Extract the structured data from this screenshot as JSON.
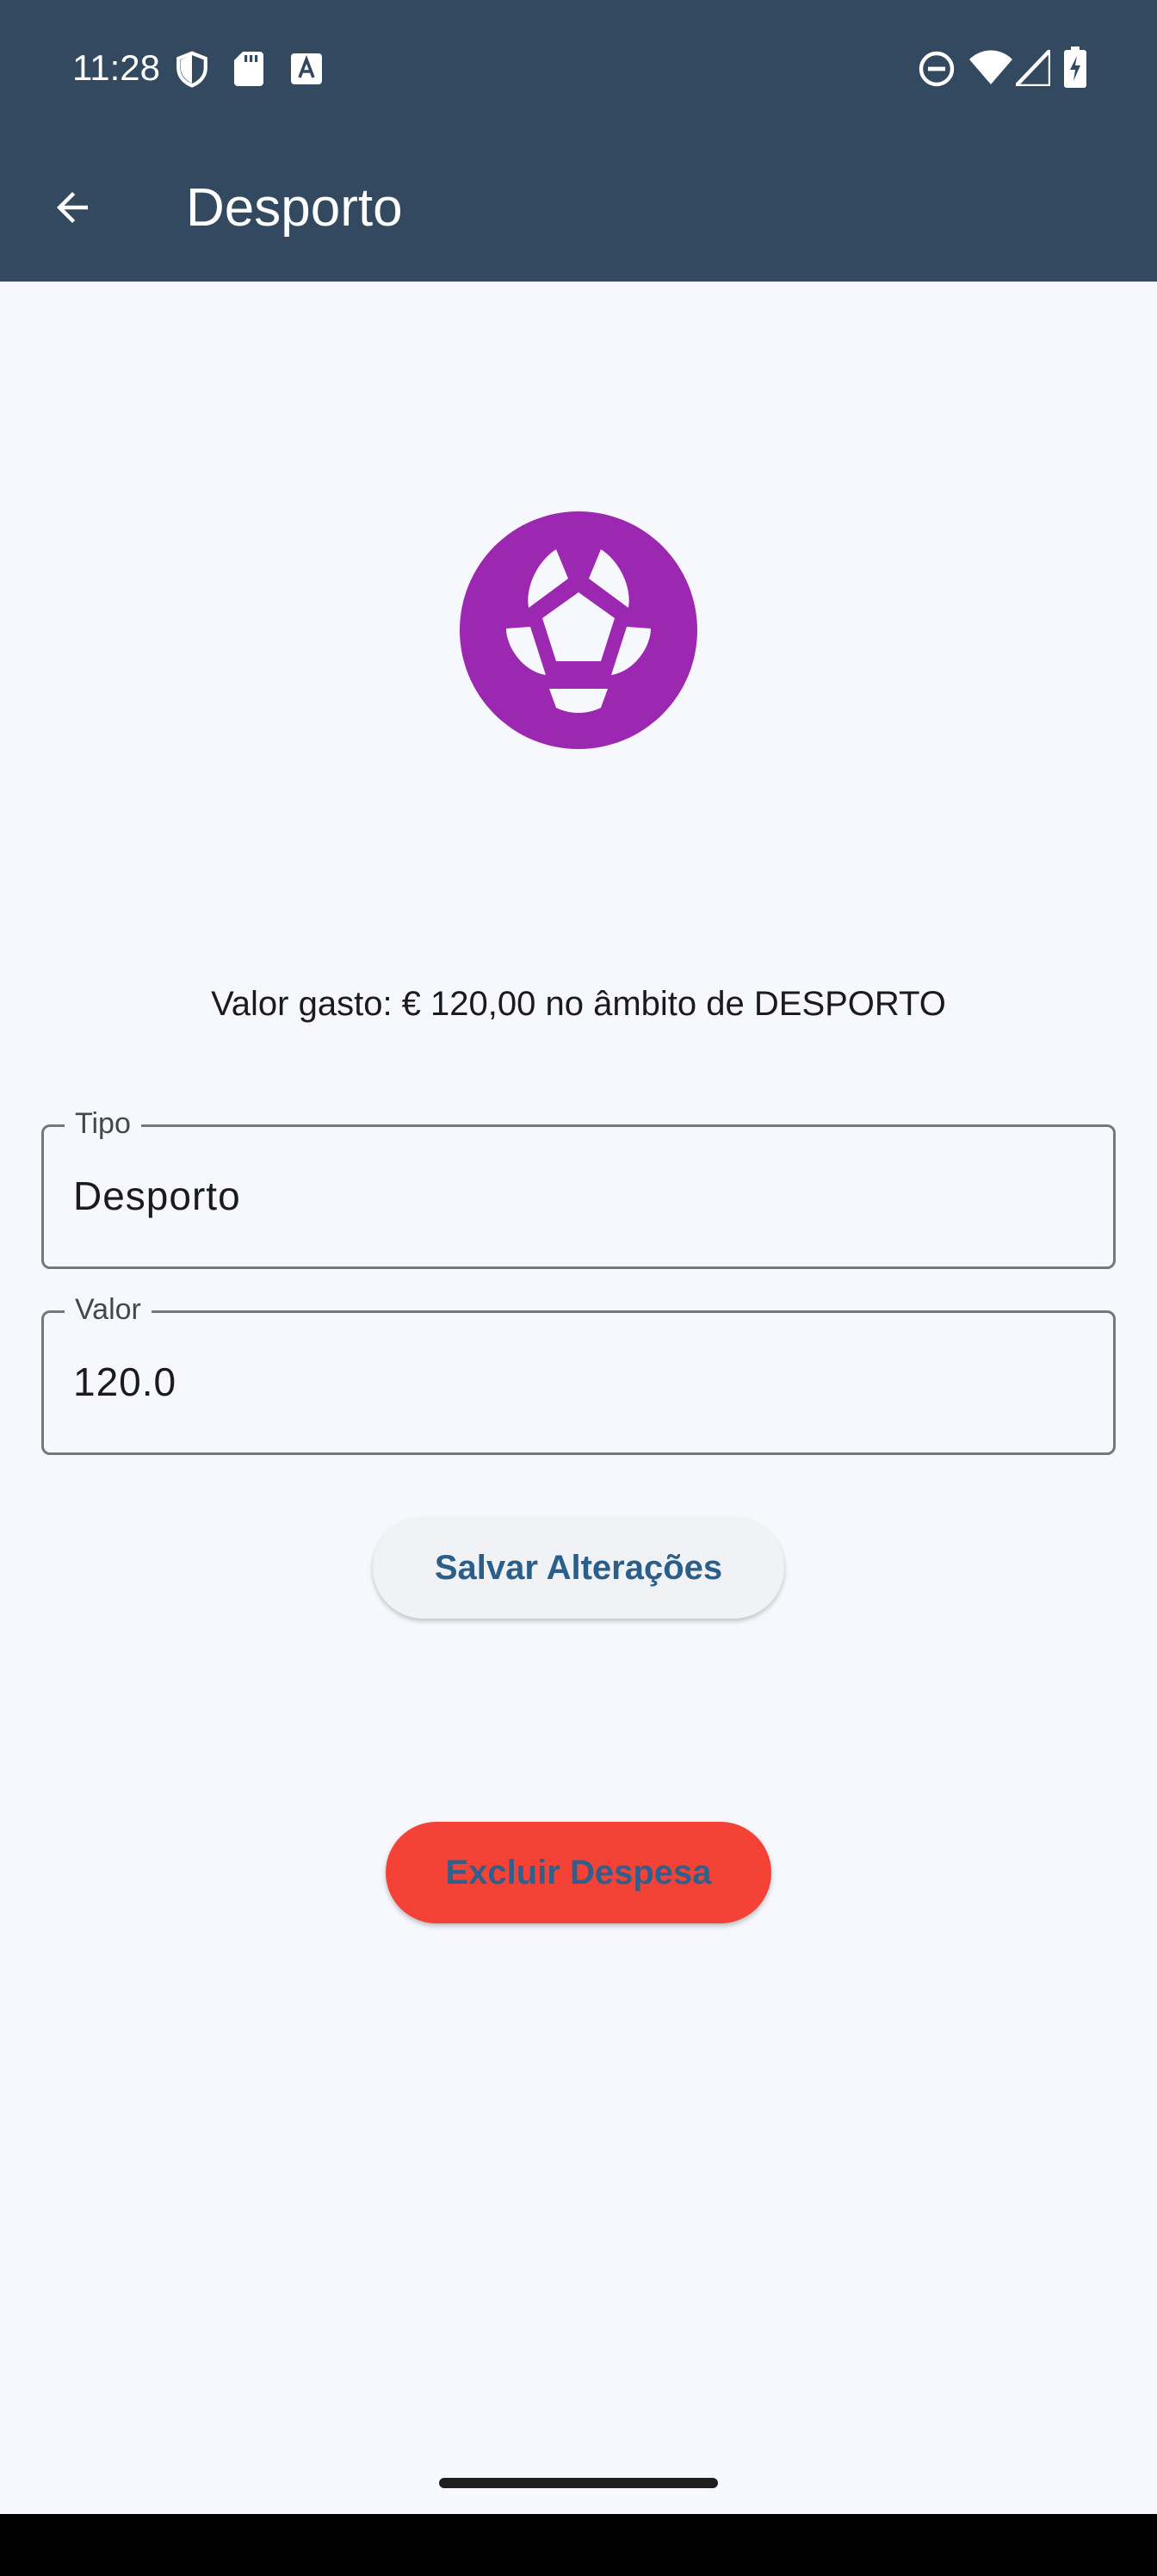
{
  "status_bar": {
    "time": "11:28",
    "left_icons": [
      "shield-icon",
      "sd-card-icon",
      "text-a-icon"
    ],
    "right_icons": [
      "do-not-disturb-icon",
      "wifi-icon",
      "cellular-signal-icon",
      "battery-charging-icon"
    ]
  },
  "app_bar": {
    "back_icon": "arrow-back-icon",
    "title": "Desporto",
    "background_color": "#32495f"
  },
  "category": {
    "icon": "soccer-ball-icon",
    "icon_color": "#9c27b0"
  },
  "summary": {
    "text": "Valor gasto: € 120,00 no âmbito de DESPORTO"
  },
  "form": {
    "tipo": {
      "label": "Tipo",
      "value": "Desporto"
    },
    "valor": {
      "label": "Valor",
      "value": "120.0"
    }
  },
  "buttons": {
    "save_label": "Salvar Alterações",
    "delete_label": "Excluir Despesa",
    "delete_color": "#f44336"
  }
}
